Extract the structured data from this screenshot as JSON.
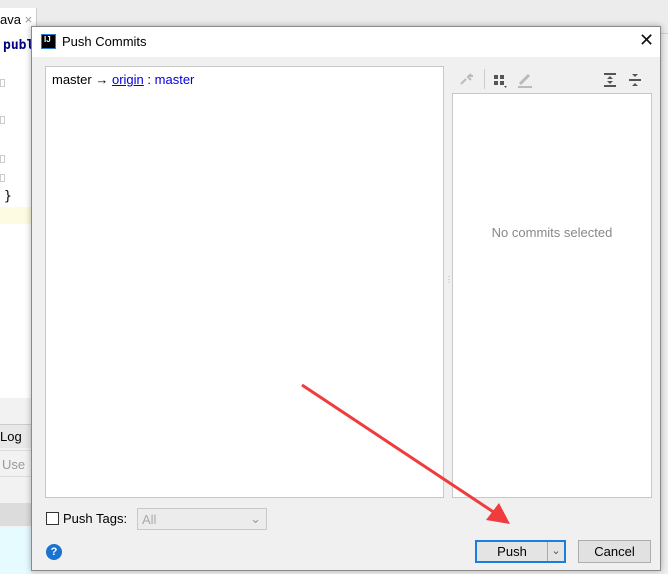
{
  "ide": {
    "tab_label": "ava",
    "tab_close": "×",
    "code_line1": "publ",
    "code_line2": "}",
    "log_tab": "Log",
    "use_text": "Use"
  },
  "dialog": {
    "logo_text": "IJ",
    "title": "Push Commits",
    "close": "✕",
    "branch": {
      "local": "master",
      "arrow": "→",
      "remote": "origin",
      "separator": ":",
      "remote_branch": "master"
    },
    "empty_state": "No commits selected",
    "toolbar_icons": [
      "cherry-pick-icon",
      "group-by-icon",
      "edit-icon",
      "expand-all-icon",
      "collapse-all-icon"
    ],
    "push_tags": {
      "label": "Push Tags:",
      "checked": false,
      "value": "All"
    },
    "help": "?",
    "push_label": "Push",
    "cancel_label": "Cancel"
  },
  "colors": {
    "accent": "#1a7de0",
    "annotation_arrow": "#f03c3c",
    "link": "#0000e0"
  }
}
